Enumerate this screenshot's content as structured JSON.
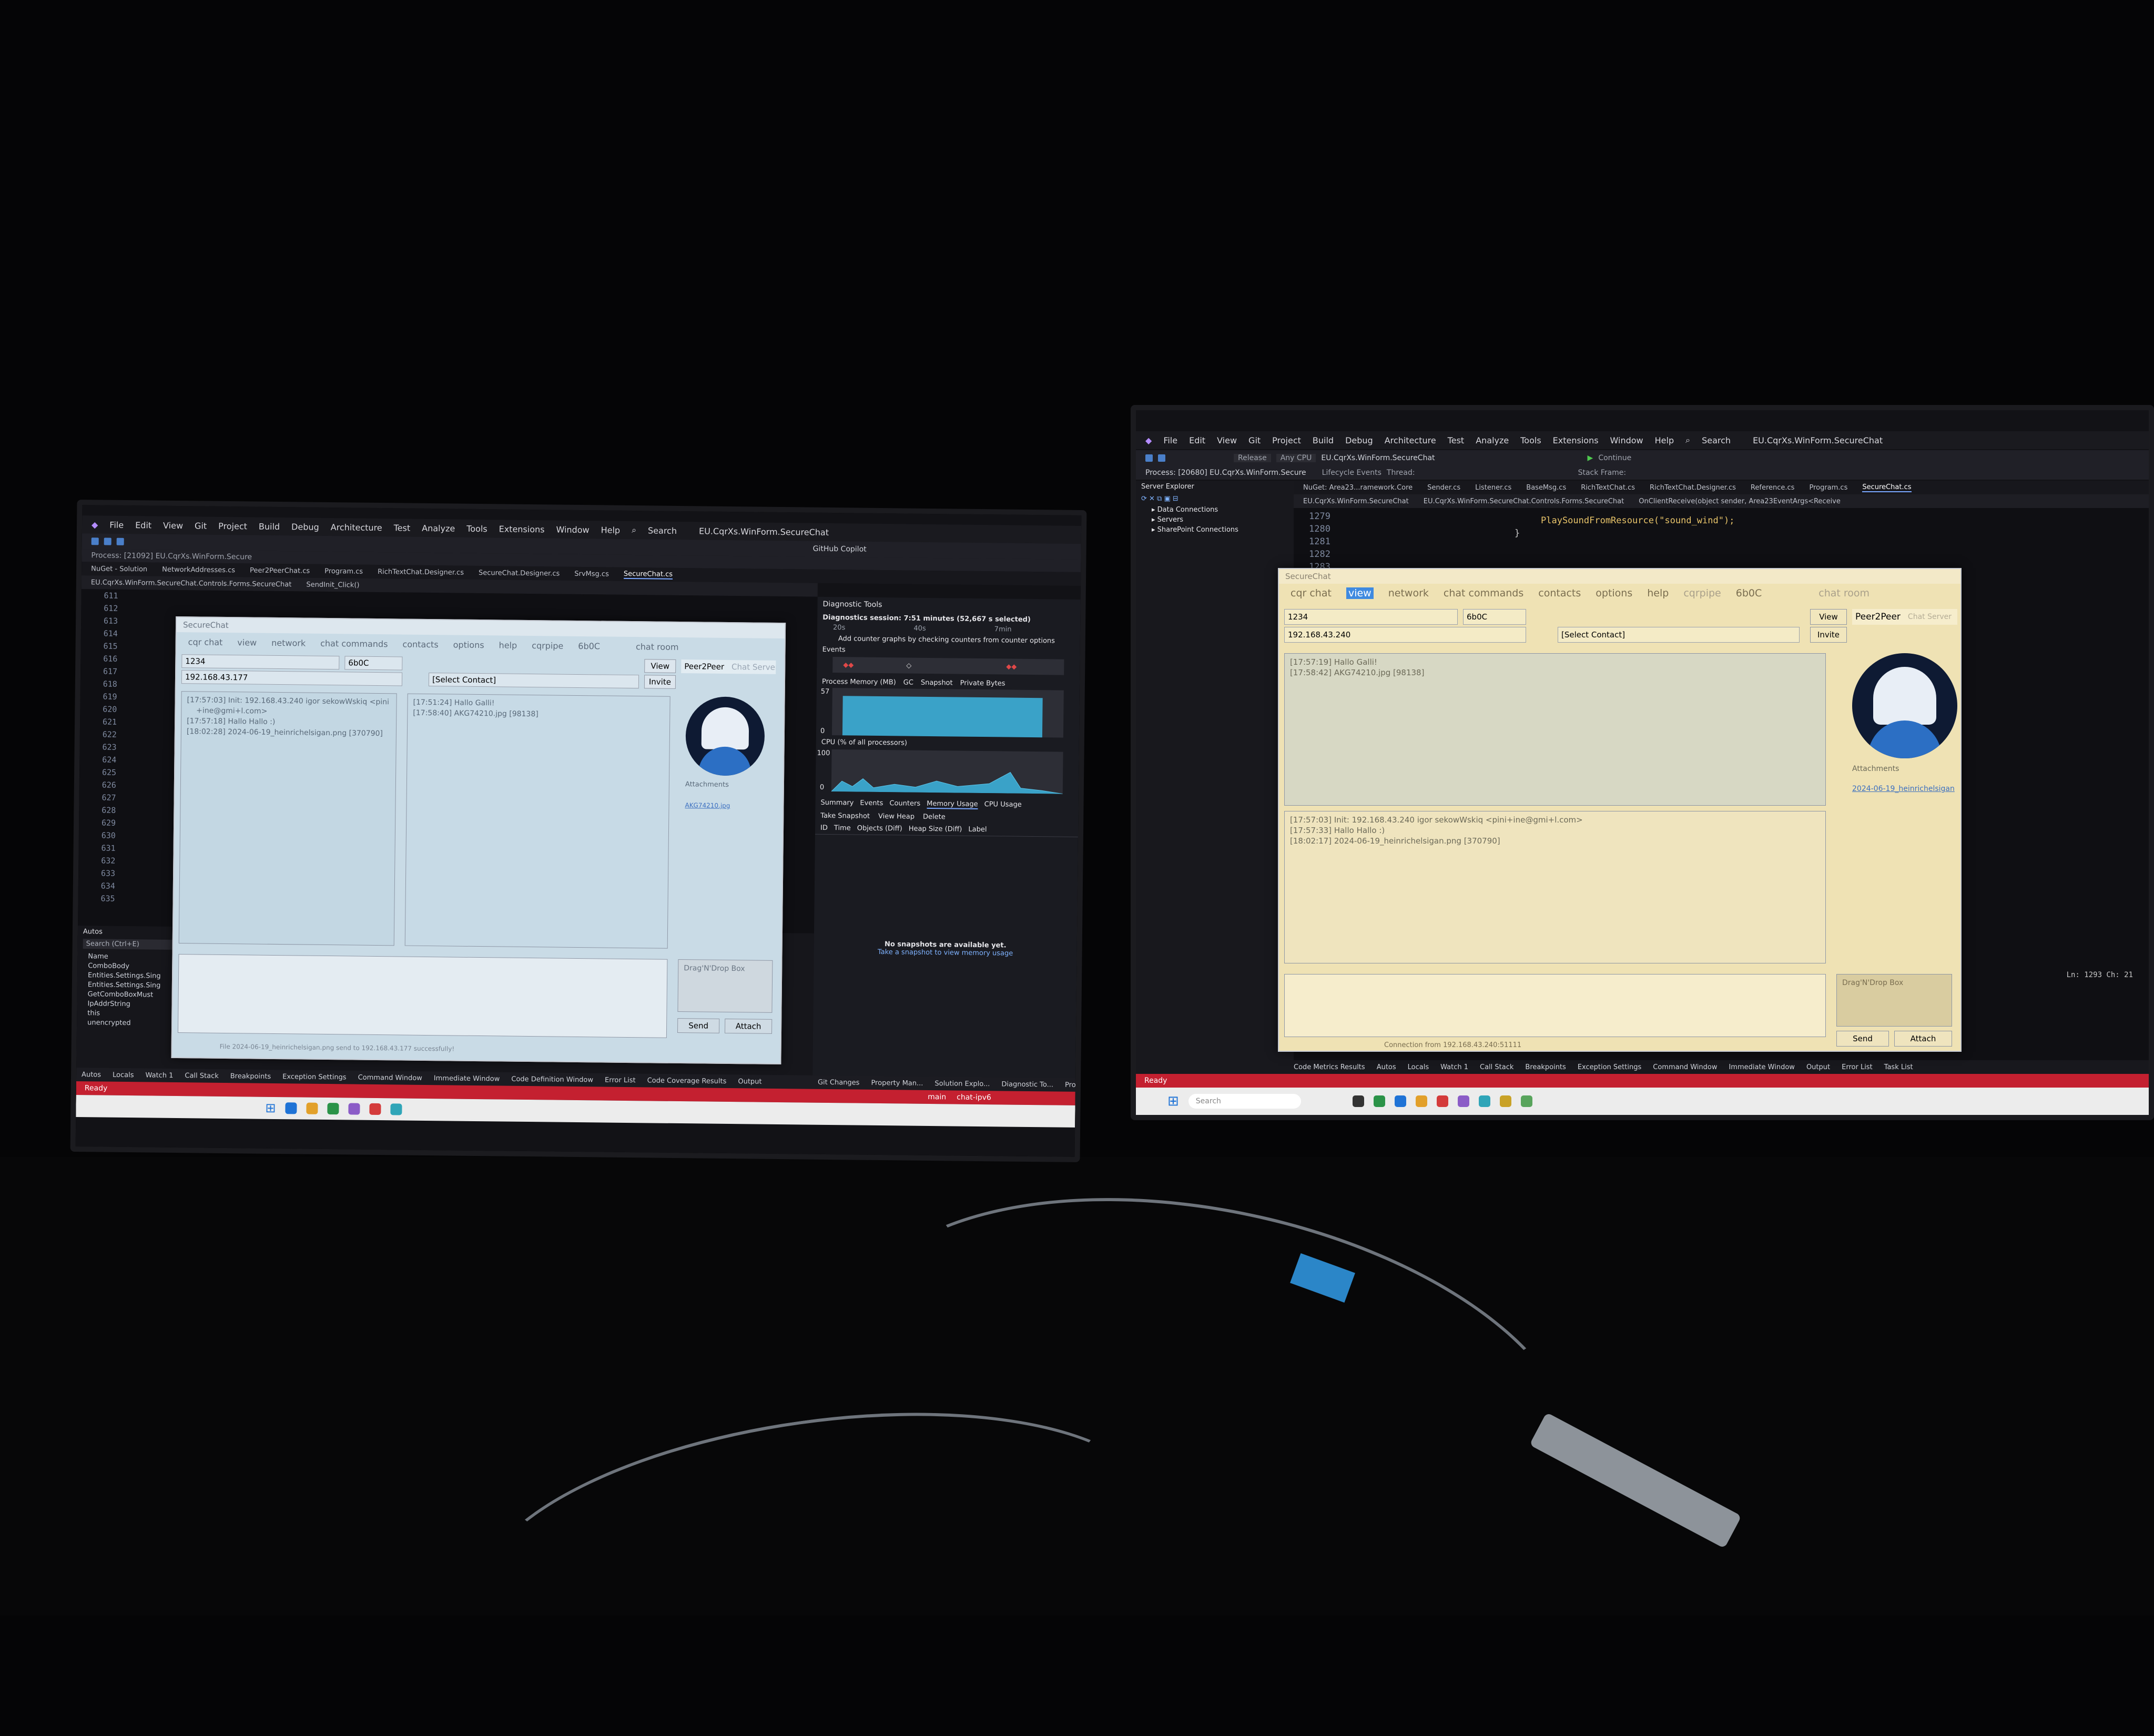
{
  "left_monitor": {
    "vs": {
      "menu": [
        "File",
        "Edit",
        "View",
        "Git",
        "Project",
        "Build",
        "Debug",
        "Architecture",
        "Test",
        "Analyze",
        "Tools",
        "Extensions",
        "Window",
        "Help"
      ],
      "search": "Search",
      "solution": "EU.CqrXs.WinForm.SecureChat",
      "process": "Process: [21092] EU.CqrXs.WinForm.Secure",
      "copilot": "GitHub Copilot",
      "doc_tabs": [
        "NuGet - Solution",
        "NetworkAddresses.cs",
        "Peer2PeerChat.cs",
        "Program.cs",
        "RichTextChat.Designer.cs",
        "SecureChat.Designer.cs",
        "SrvMsg.cs",
        "SecureChat.cs"
      ],
      "nav_class": "EU.CqrXs.WinForm.SecureChat.Controls.Forms.SecureChat",
      "nav_member": "SendInit_Click()",
      "line_numbers": [
        "611",
        "612",
        "613",
        "614",
        "615",
        "616",
        "617",
        "618",
        "619",
        "620",
        "621",
        "622",
        "623",
        "624",
        "625",
        "626",
        "627",
        "628",
        "629",
        "630",
        "631",
        "632",
        "633",
        "634",
        "635"
      ],
      "autos_title": "Autos",
      "autos_search": "Search (Ctrl+E)",
      "autos_items": [
        "Name",
        "ComboBody",
        "Entities.Settings.Sing",
        "Entities.Settings.Sing",
        "GetComboBoxMust",
        "IpAddrString",
        "this",
        "unencrypted"
      ],
      "bottom_tabs": [
        "Autos",
        "Locals",
        "Watch 1",
        "Call Stack",
        "Breakpoints",
        "Exception Settings",
        "Command Window",
        "Immediate Window",
        "Code Definition Window",
        "Error List",
        "Code Coverage Results",
        "Output"
      ],
      "right_bottom_tabs": [
        "Git Changes",
        "Property Man...",
        "Solution Explo...",
        "Diagnostic To...",
        "Properties"
      ],
      "status": "Ready",
      "status_right": "main",
      "branch": "chat-ipv6"
    },
    "diagnostics": {
      "title": "Diagnostic Tools",
      "session": "Diagnostics session: 7:51 minutes (52,667 s selected)",
      "ticks": [
        "20s",
        "40s",
        "7min"
      ],
      "hint": "Add counter graphs by checking counters from counter options",
      "events_label": "Events",
      "memory_label": "Process Memory (MB)",
      "memory_legend": [
        "GC",
        "Snapshot",
        "Private Bytes"
      ],
      "memory_max": "57",
      "memory_min": "0",
      "cpu_label": "CPU (% of all processors)",
      "cpu_max": "100",
      "cpu_min": "0",
      "tabs": [
        "Summary",
        "Events",
        "Counters",
        "Memory Usage",
        "CPU Usage"
      ],
      "snapshot_buttons": [
        "Take Snapshot",
        "View Heap",
        "Delete"
      ],
      "columns": [
        "ID",
        "Time",
        "Objects (Diff)",
        "Heap Size (Diff)",
        "Label"
      ],
      "empty_line1": "No snapshots are available yet.",
      "empty_line2": "Take a snapshot to view memory usage"
    },
    "chat": {
      "title": "SecureChat",
      "menu": [
        "cqr chat",
        "view",
        "network",
        "chat commands",
        "contacts",
        "options",
        "help",
        "cqrpipe",
        "6b0C",
        "chat room"
      ],
      "key": "1234",
      "key_suffix": "6b0C",
      "address": "192.168.43.177",
      "select_contact": "[Select Contact]",
      "btn_view": "View",
      "btn_invite": "Invite",
      "peer": "Peer2Peer",
      "chat_server": "Chat Server",
      "left_pane": "[17:57:03] Init: 192.168.43.240 igor sekowWskiq <pini\n    +ine@gmi+l.com>\n[17:57:18] Hallo Hallo :)\n[18:02:28] 2024-06-19_heinrichelsigan.png [370790]",
      "right_pane": "[17:51:24] Hallo Galli!\n[17:58:40] AKG74210.jpg [98138]",
      "attachments": "Attachments",
      "attach_link": "AKG74210.jpg",
      "drop": "Drag'N'Drop Box",
      "send": "Send",
      "attach": "Attach",
      "statusline": "File 2024-06-19_heinrichelsigan.png send to 192.168.43.177 successfully!"
    }
  },
  "right_monitor": {
    "vs": {
      "menu": [
        "File",
        "Edit",
        "View",
        "Git",
        "Project",
        "Build",
        "Debug",
        "Architecture",
        "Test",
        "Analyze",
        "Tools",
        "Extensions",
        "Window",
        "Help"
      ],
      "search": "Search",
      "solution": "EU.CqrXs.WinForm.SecureChat",
      "config": "Release",
      "platform": "Any CPU",
      "run_target": "EU.CqrXs.WinForm.SecureChat",
      "continue": "Continue",
      "process": "Process: [20680] EU.CqrXs.WinForm.Secure",
      "lifecycle": "Lifecycle Events",
      "thread": "Thread:",
      "stack_frame": "Stack Frame:",
      "server_explorer": "Server Explorer",
      "server_items": [
        "Data Connections",
        "Servers",
        "SharePoint Connections"
      ],
      "doc_tabs": [
        "NuGet: Area23...ramework.Core",
        "Sender.cs",
        "Listener.cs",
        "BaseMsg.cs",
        "RichTextChat.cs",
        "RichTextChat.Designer.cs",
        "Reference.cs",
        "Program.cs",
        "SecureChat.cs"
      ],
      "nav_project": "EU.CqrXs.WinForm.SecureChat",
      "nav_class": "EU.CqrXs.WinForm.SecureChat.Controls.Forms.SecureChat",
      "nav_member": "OnClientReceive(object sender, Area23EventArgs<Receive",
      "line_numbers": [
        "1279",
        "1280",
        "1281",
        "1282",
        "1283"
      ],
      "code_line": "PlaySoundFromResource(\"sound_wind\");",
      "code_brace": "}",
      "position": "Ln: 1293   Ch: 21",
      "bottom_tabs": [
        "Code Metrics Results",
        "Autos",
        "Locals",
        "Watch 1",
        "Call Stack",
        "Breakpoints",
        "Exception Settings",
        "Command Window",
        "Immediate Window",
        "Output",
        "Error List",
        "Task List"
      ],
      "status": "Ready",
      "taskbar_search": "Search"
    },
    "chat": {
      "title": "SecureChat",
      "menu": [
        "cqr chat",
        "view",
        "network",
        "chat commands",
        "contacts",
        "options",
        "help",
        "cqrpipe",
        "6b0C",
        "chat room"
      ],
      "key": "1234",
      "key_suffix": "6b0C",
      "address": "192.168.43.240",
      "select_contact": "[Select Contact]",
      "btn_view": "View",
      "btn_invite": "Invite",
      "peer": "Peer2Peer",
      "chat_server": "Chat Server",
      "top_pane": "[17:57:19] Hallo Galli!\n[17:58:42] AKG74210.jpg [98138]",
      "bottom_pane": "[17:57:03] Init: 192.168.43.240 igor sekowWskiq <pini+ine@gmi+l.com>\n[17:57:33] Hallo Hallo :)\n[18:02:17] 2024-06-19_heinrichelsigan.png [370790]",
      "attachments": "Attachments",
      "attach_link": "2024-06-19_heinrichelsigan",
      "drop": "Drag'N'Drop Box",
      "send": "Send",
      "attach": "Attach",
      "statusline": "Connection from 192.168.43.240:51111"
    }
  },
  "colors": {
    "vs_status": "#c42030",
    "chat_left_bg": "#c9dbe6",
    "chat_right_bg": "#efe2b4",
    "menu_highlight": "#3f8ae0",
    "chart_fill": "#3aa2c8"
  }
}
